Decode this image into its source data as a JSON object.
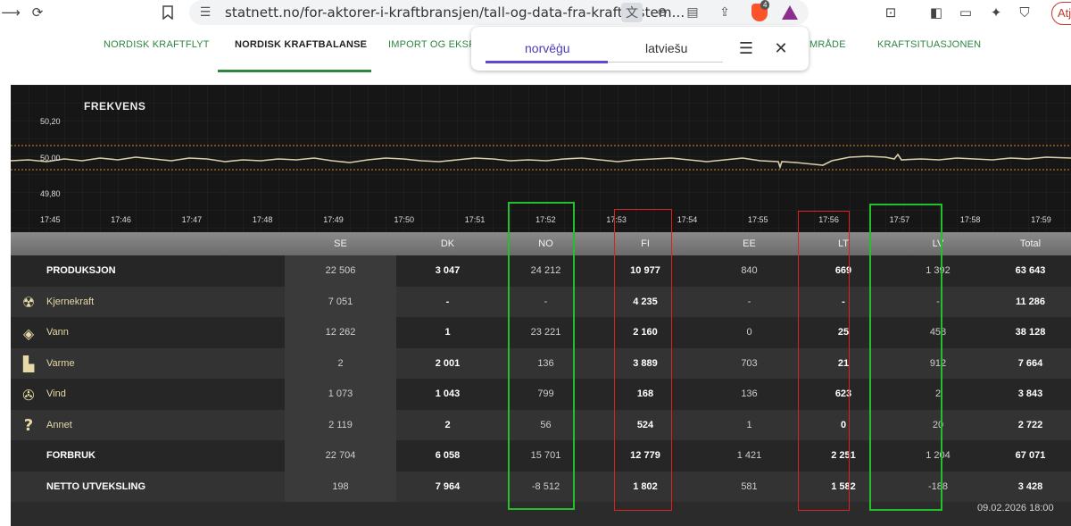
{
  "browser": {
    "url": "statnett.no/for-aktorer-i-kraftbransjen/tall-og-data-fra-kraftsystem...",
    "profile_label": "Atjau",
    "brave_badge": "4"
  },
  "nav": {
    "items": [
      "NORDISK KRAFTFLYT",
      "NORDISK KRAFTBALANSE",
      "IMPORT OG EKSPO",
      "MRÅDE",
      "KRAFTSITUASJONEN"
    ],
    "active_index": 1
  },
  "translate": {
    "source_lang": "norvēģu",
    "target_lang": "latviešu"
  },
  "frequency": {
    "title": "FREKVENS",
    "y_ticks": [
      "50,20",
      "50,00",
      "49,80"
    ],
    "x_ticks": [
      "17:45",
      "17:46",
      "17:47",
      "17:48",
      "17:49",
      "17:50",
      "17:51",
      "17:52",
      "17:53",
      "17:54",
      "17:55",
      "17:56",
      "17:57",
      "17:58",
      "17:59"
    ],
    "line_color": "#d8cfa8",
    "limit_color": "#d98a2b"
  },
  "table": {
    "columns": [
      "",
      "SE",
      "DK",
      "NO",
      "FI",
      "EE",
      "LT",
      "LV",
      "Total"
    ],
    "rows": [
      {
        "icon": "",
        "label": "PRODUKSJON",
        "values": [
          "22 506",
          "3 047",
          "24 212",
          "10 977",
          "840",
          "669",
          "1 392",
          "63 643"
        ],
        "type": "hdr"
      },
      {
        "icon": "nuclear-icon",
        "label": "Kjernekraft",
        "values": [
          "7 051",
          "-",
          "-",
          "4 235",
          "-",
          "-",
          "-",
          "11 286"
        ],
        "type": "sub"
      },
      {
        "icon": "water-drop-icon",
        "label": "Vann",
        "values": [
          "12 262",
          "1",
          "23 221",
          "2 160",
          "0",
          "25",
          "458",
          "38 128"
        ],
        "type": "sub"
      },
      {
        "icon": "factory-icon",
        "label": "Varme",
        "values": [
          "2",
          "2 001",
          "136",
          "3 889",
          "703",
          "21",
          "912",
          "7 664"
        ],
        "type": "sub"
      },
      {
        "icon": "wind-turbine-icon",
        "label": "Vind",
        "values": [
          "1 073",
          "1 043",
          "799",
          "168",
          "136",
          "623",
          "2",
          "3 843"
        ],
        "type": "sub"
      },
      {
        "icon": "question-icon",
        "label": "Annet",
        "values": [
          "2 119",
          "2",
          "56",
          "524",
          "1",
          "0",
          "20",
          "2 722"
        ],
        "type": "sub"
      },
      {
        "icon": "",
        "label": "FORBRUK",
        "values": [
          "22 704",
          "6 058",
          "15 701",
          "12 779",
          "1 421",
          "2 251",
          "1 204",
          "67 071"
        ],
        "type": "hdr"
      },
      {
        "icon": "",
        "label": "NETTO UTVEKSLING",
        "values": [
          "198",
          "7 964",
          "-8 512",
          "1 802",
          "581",
          "1 582",
          "-188",
          "3 428"
        ],
        "type": "hdr"
      }
    ]
  },
  "timestamp": "09.02.2026 18:00",
  "highlight_colors": {
    "green": "#22c02a",
    "red": "#e0201e"
  }
}
